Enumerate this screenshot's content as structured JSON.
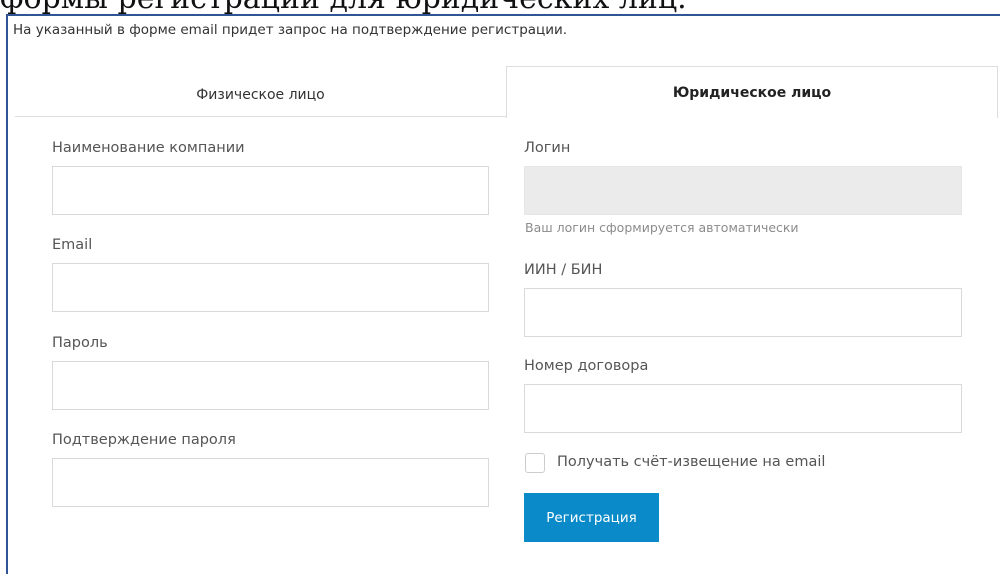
{
  "caption": "формы регистрации для юридических лиц.",
  "notice": "На указанный в форме email придет запрос на подтверждение регистрации.",
  "tabs": {
    "physical": "Физическое лицо",
    "legal": "Юридическое лицо",
    "active": "legal"
  },
  "form": {
    "company_name": {
      "label": "Наименование компании",
      "value": ""
    },
    "email": {
      "label": "Email",
      "value": ""
    },
    "password": {
      "label": "Пароль",
      "value": ""
    },
    "password_confirm": {
      "label": "Подтверждение пароля",
      "value": ""
    },
    "login": {
      "label": "Логин",
      "value": "",
      "hint": "Ваш логин сформируется автоматически",
      "disabled": true
    },
    "iin_bin": {
      "label": "ИИН / БИН",
      "value": ""
    },
    "contract_number": {
      "label": "Номер договора",
      "value": ""
    },
    "invoice_checkbox": {
      "label": "Получать счёт-извещение на email",
      "checked": false
    },
    "submit_label": "Регистрация"
  },
  "colors": {
    "accent": "#0a8ac8",
    "frame_border": "#2f5597",
    "disabled_input": "#ebebeb"
  }
}
